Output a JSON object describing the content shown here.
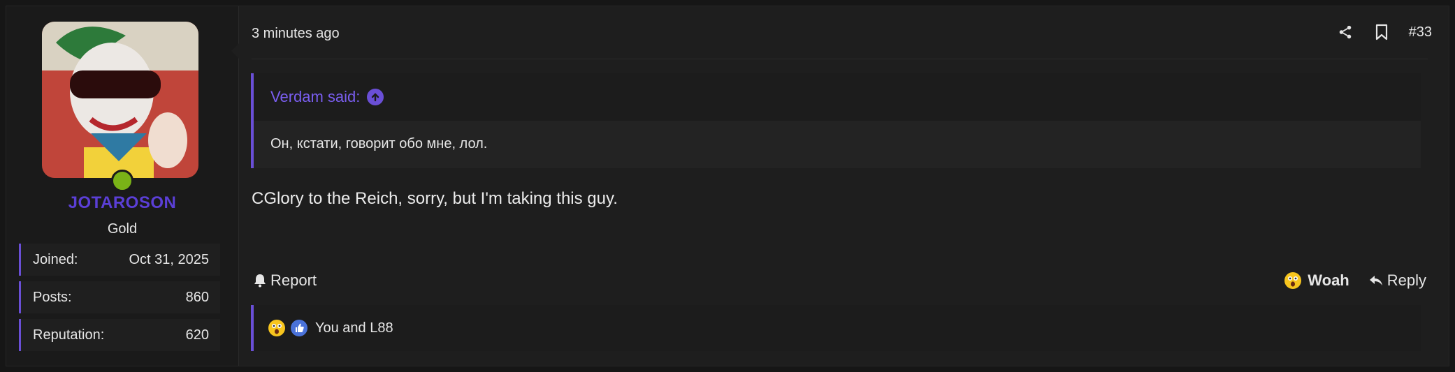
{
  "user": {
    "name": "JOTAROSON",
    "title": "Gold",
    "stats": [
      {
        "label": "Joined:",
        "value": "Oct 31, 2025"
      },
      {
        "label": "Posts:",
        "value": "860"
      },
      {
        "label": "Reputation:",
        "value": "620"
      }
    ]
  },
  "post": {
    "time": "3 minutes ago",
    "number": "#33",
    "quote": {
      "author": "Verdam said:",
      "text": "Он, кстати, говорит обо мне, лол."
    },
    "message": "CGlory to the Reich, sorry, but I'm taking this guy.",
    "actions": {
      "report": "Report",
      "react": "Woah",
      "reply": "Reply"
    },
    "reactions_text": "You and L88"
  },
  "colors": {
    "accent": "#6a4fd6",
    "username": "#5b3fd6",
    "online": "#7ab317"
  }
}
